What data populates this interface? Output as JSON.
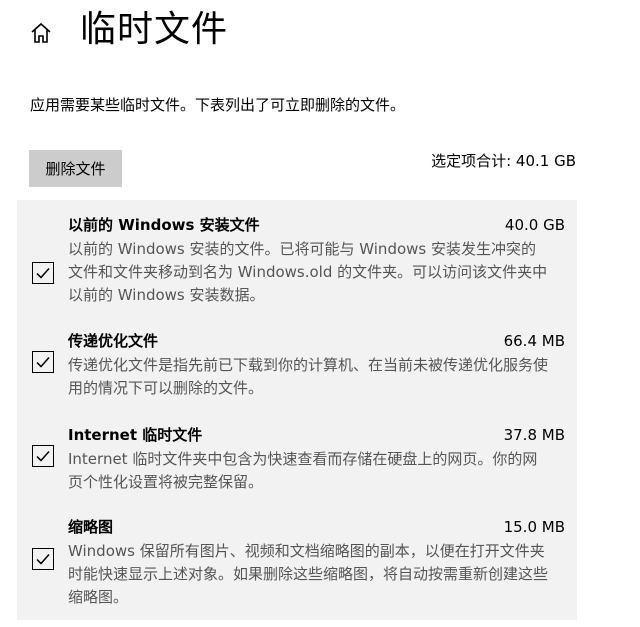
{
  "header": {
    "title": "临时文件",
    "home_icon": "home-icon"
  },
  "description": "应用需要某些临时文件。下表列出了可立即删除的文件。",
  "actions": {
    "delete_label": "删除文件",
    "selected_total": "选定项合计: 40.1 GB"
  },
  "items": [
    {
      "name": "以前的 Windows 安装文件",
      "size": "40.0 GB",
      "description": "以前的 Windows 安装的文件。已将可能与 Windows 安装发生冲突的文件和文件夹移动到名为 Windows.old 的文件夹。可以访问该文件夹中以前的 Windows 安装数据。",
      "checked": true
    },
    {
      "name": "传递优化文件",
      "size": "66.4 MB",
      "description": "传递优化文件是指先前已下载到你的计算机、在当前未被传递优化服务使用的情况下可以删除的文件。",
      "checked": true
    },
    {
      "name": "Internet 临时文件",
      "size": "37.8 MB",
      "description": "Internet 临时文件夹中包含为快速查看而存储在硬盘上的网页。你的网页个性化设置将被完整保留。",
      "checked": true
    },
    {
      "name": "缩略图",
      "size": "15.0 MB",
      "description": "Windows 保留所有图片、视频和文档缩略图的副本，以便在打开文件夹时能快速显示上述对象。如果删除这些缩略图，将自动按需重新创建这些缩略图。",
      "checked": true
    }
  ]
}
